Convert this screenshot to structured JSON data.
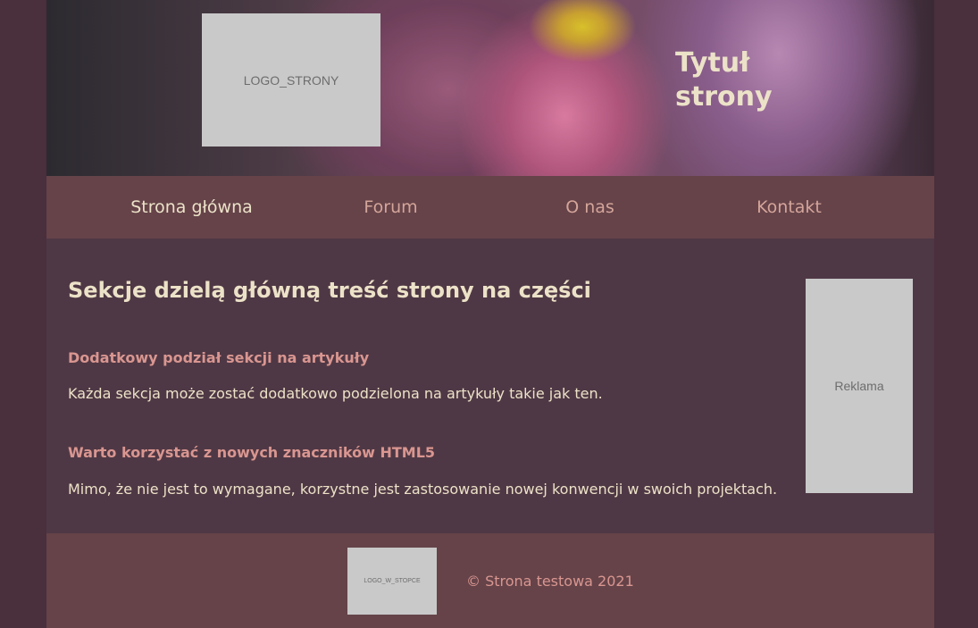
{
  "header": {
    "logo_text": "LOGO_STRONY",
    "title_line1": "Tytuł",
    "title_line2": "strony"
  },
  "nav": {
    "items": [
      {
        "label": "Strona główna",
        "active": true
      },
      {
        "label": "Forum",
        "active": false
      },
      {
        "label": "O nas",
        "active": false
      },
      {
        "label": "Kontakt",
        "active": false
      }
    ]
  },
  "main": {
    "section_title": "Sekcje dzielą główną treść strony na części",
    "articles": [
      {
        "title": "Dodatkowy podział sekcji na artykuły",
        "text": "Każda sekcja może zostać dodatkowo podzielona na artykuły takie jak ten."
      },
      {
        "title": "Warto korzystać z nowych znaczników HTML5",
        "text": "Mimo, że nie jest to wymagane, korzystne jest zastosowanie nowej konwencji w swoich projektach."
      }
    ],
    "ad_text": "Reklama"
  },
  "footer": {
    "logo_text": "LOGO_W_STOPCE",
    "copyright": "© Strona testowa 2021"
  },
  "colors": {
    "background": "#4a2f3d",
    "nav_background": "#654349",
    "heading": "#ece2c8",
    "accent": "#d99690"
  }
}
